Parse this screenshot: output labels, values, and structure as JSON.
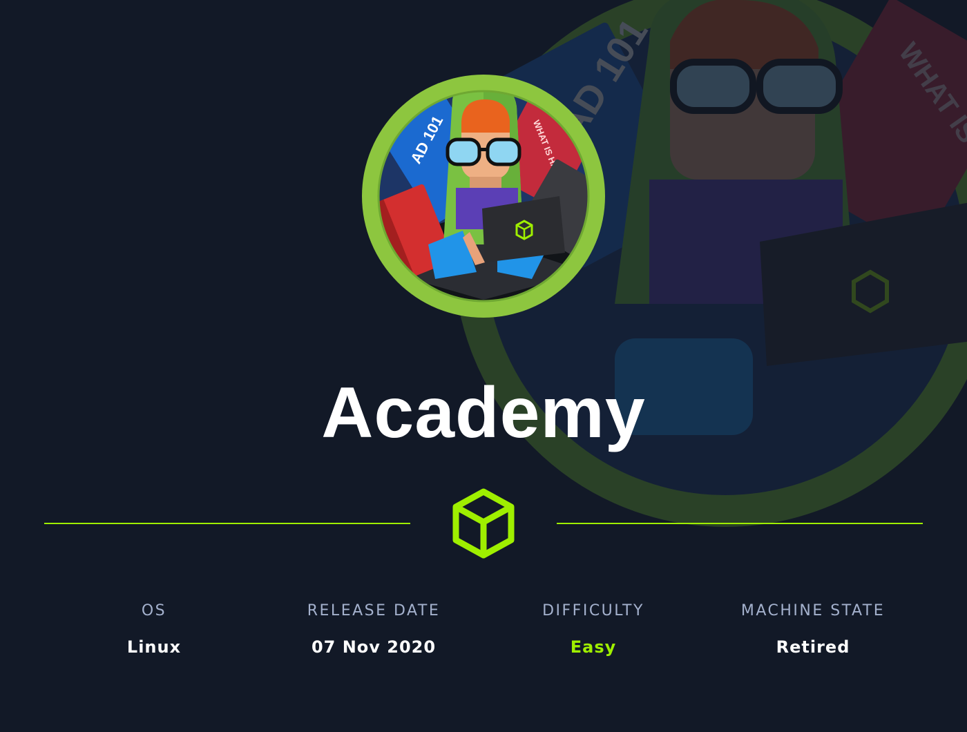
{
  "machine": {
    "name": "Academy"
  },
  "stats": {
    "os": {
      "label": "OS",
      "value": "Linux"
    },
    "release_date": {
      "label": "RELEASE DATE",
      "value": "07 Nov 2020"
    },
    "difficulty": {
      "label": "DIFFICULTY",
      "value": "Easy"
    },
    "machine_state": {
      "label": "MACHINE STATE",
      "value": "Retired"
    }
  },
  "artwork": {
    "book_ad101": "AD 101",
    "book_what_is_hacking": "WHAT IS HACKING?"
  },
  "colors": {
    "background": "#121927",
    "accent_green": "#9fef00",
    "avatar_ring": "#8dc63f",
    "label_gray": "#a4b1cd",
    "text_white": "#ffffff"
  },
  "icons": [
    "hackthebox-cube-icon",
    "machine-avatar"
  ]
}
